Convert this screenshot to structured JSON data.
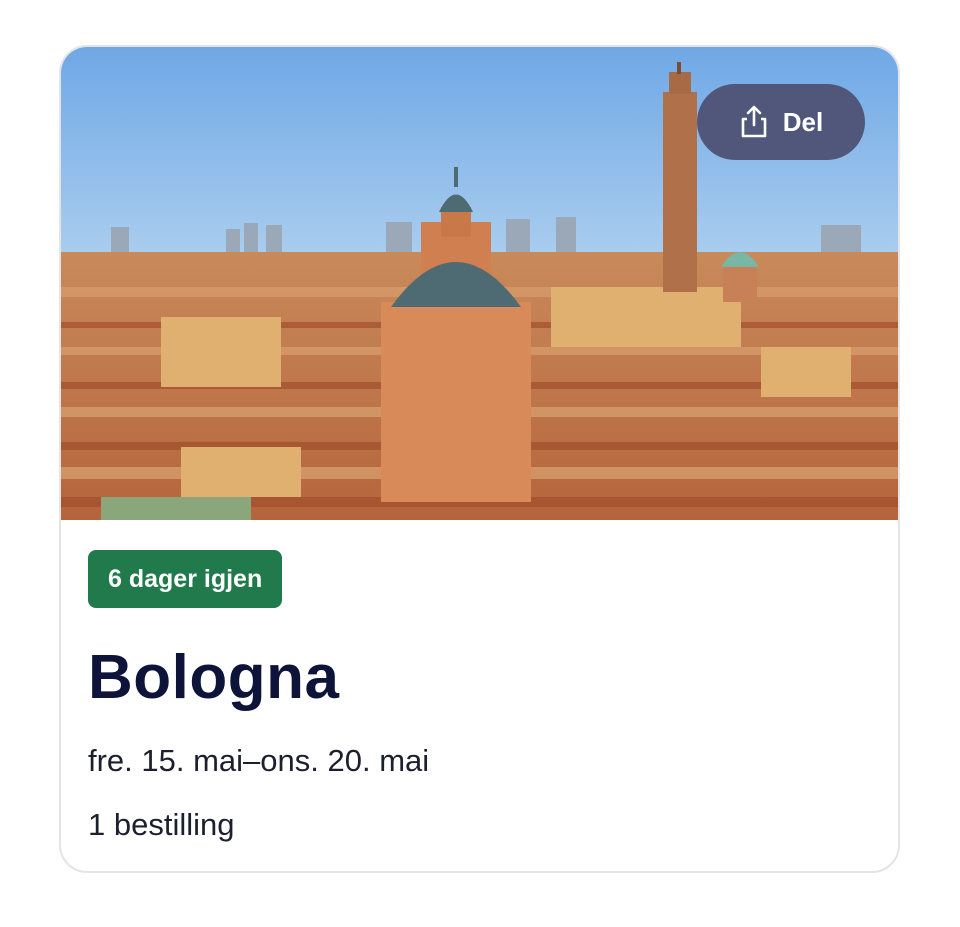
{
  "trip": {
    "share_label": "Del",
    "share_icon": "share-icon",
    "days_left_badge": "6 dager igjen",
    "title": "Bologna",
    "date_range": "fre. 15. mai–ons. 20. mai",
    "bookings": "1 bestilling"
  },
  "colors": {
    "badge_bg": "#217a4b",
    "share_bg": "#51577a",
    "title": "#0e1339"
  }
}
